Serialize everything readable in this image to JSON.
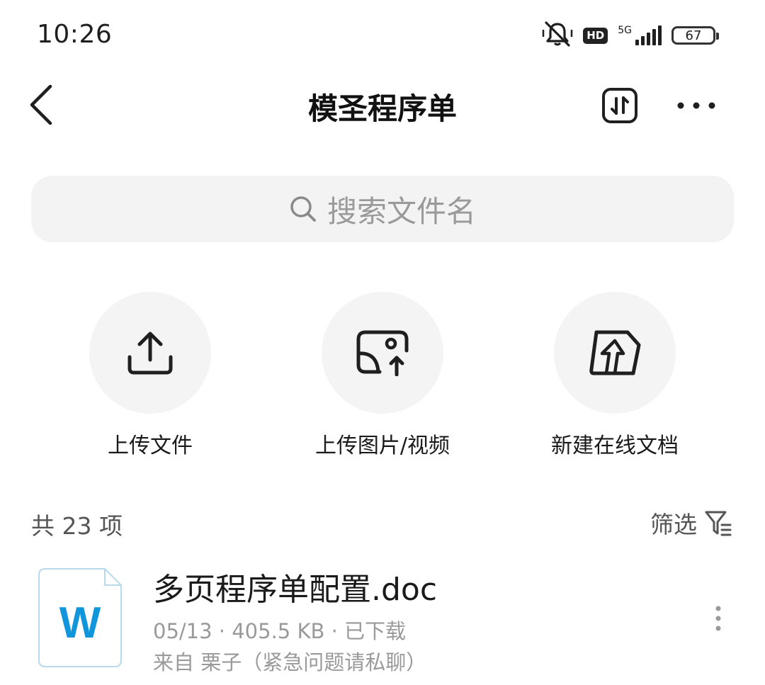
{
  "status_bar": {
    "time": "10:26",
    "hd_label": "HD",
    "network_label": "5G",
    "battery": "67",
    "icons": [
      "mute-icon",
      "hd-icon",
      "signal-icon",
      "battery-icon"
    ]
  },
  "header": {
    "title": "模圣程序单",
    "icons": [
      "back-icon",
      "sort-icon",
      "more-icon"
    ]
  },
  "search": {
    "placeholder": "搜索文件名"
  },
  "actions": [
    {
      "label": "上传文件",
      "icon": "upload-icon"
    },
    {
      "label": "上传图片/视频",
      "icon": "image-upload-icon"
    },
    {
      "label": "新建在线文档",
      "icon": "new-doc-icon"
    }
  ],
  "list": {
    "count_label": "共 23 项",
    "filter_label": "筛选"
  },
  "files": [
    {
      "name": "多页程序单配置.doc",
      "meta": "05/13 · 405.5 KB · 已下载",
      "source": "来自 栗子（紧急问题请私聊）",
      "type_letter": "W",
      "type_color": "#1296db"
    }
  ],
  "colors": {
    "accent_word": "#1296db",
    "secondary_text": "#9a9a9a",
    "surface": "#f3f3f3"
  }
}
